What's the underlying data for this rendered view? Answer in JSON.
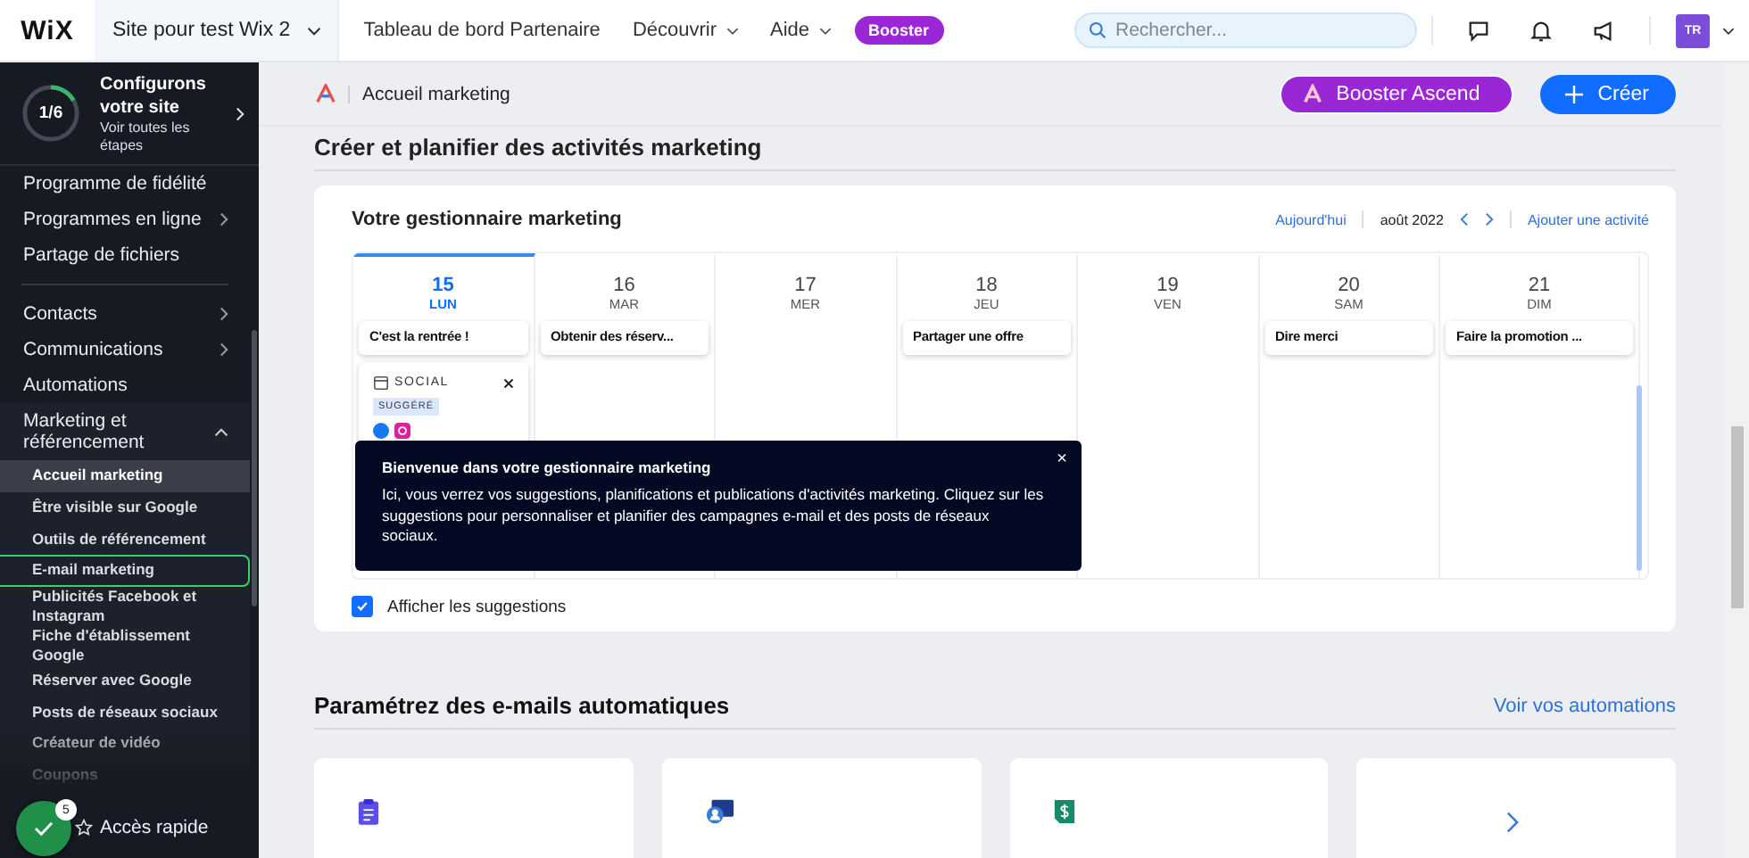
{
  "top_bar": {
    "logo": "WiX",
    "site_selector": "Site pour test Wix 2",
    "nav": [
      {
        "label": "Tableau de bord Partenaire",
        "has_menu": false
      },
      {
        "label": "Découvrir",
        "has_menu": true
      },
      {
        "label": "Aide",
        "has_menu": true
      }
    ],
    "booster": "Booster",
    "search": {
      "placeholder": "Rechercher..."
    },
    "avatar": "TR"
  },
  "sidebar": {
    "setup": {
      "progress": "1/6",
      "level": 0.167,
      "title": "Configurons votre site",
      "link": "Voir toutes les étapes"
    },
    "items": [
      {
        "kind": "item",
        "label": "Programme de fidélité",
        "has_arrow": false
      },
      {
        "kind": "item",
        "label": "Programmes en ligne",
        "has_arrow": true
      },
      {
        "kind": "item",
        "label": "Partage de fichiers",
        "has_arrow": false
      },
      {
        "kind": "divider"
      },
      {
        "kind": "item",
        "label": "Contacts",
        "has_arrow": true
      },
      {
        "kind": "item",
        "label": "Communications",
        "has_arrow": true
      },
      {
        "kind": "item",
        "label": "Automations",
        "has_arrow": false
      },
      {
        "kind": "group",
        "label": "Marketing et référencement",
        "expanded": true,
        "children": [
          {
            "label": "Accueil marketing",
            "selected": true,
            "focused": false
          },
          {
            "label": "Être visible sur Google",
            "selected": false,
            "focused": false
          },
          {
            "label": "Outils de référencement",
            "selected": false,
            "focused": false
          },
          {
            "label": "E-mail marketing",
            "selected": false,
            "focused": true
          },
          {
            "label": "Publicités Facebook et Instagram",
            "selected": false,
            "focused": false
          },
          {
            "label": "Fiche d'établissement Google",
            "selected": false,
            "focused": false
          },
          {
            "label": "Réserver avec Google",
            "selected": false,
            "focused": false
          },
          {
            "label": "Posts de réseaux sociaux",
            "selected": false,
            "focused": false
          },
          {
            "label": "Créateur de vidéo",
            "selected": false,
            "focused": false
          },
          {
            "label": "Coupons",
            "selected": false,
            "focused": false
          }
        ]
      }
    ],
    "quick_access": {
      "label": "Accès rapide",
      "badge": "5"
    }
  },
  "main": {
    "breadcrumb": "Accueil marketing",
    "booster_button": "Booster Ascend",
    "create_button": "Créer",
    "section_title": "Créer et planifier des activités marketing",
    "calendar": {
      "title": "Votre gestionnaire marketing",
      "today": "Aujourd'hui",
      "month": "août 2022",
      "add": "Ajouter une activité",
      "days": [
        {
          "day": "15",
          "weekday": "LUN",
          "selected": true,
          "event": "C'est la rentrée !",
          "suggestion": {
            "label": "SOCIAL",
            "tag": "SUGGÉRÉ"
          }
        },
        {
          "day": "16",
          "weekday": "MAR",
          "selected": false,
          "event": "Obtenir des réserv..."
        },
        {
          "day": "17",
          "weekday": "MER",
          "selected": false
        },
        {
          "day": "18",
          "weekday": "JEU",
          "selected": false,
          "event": "Partager une offre"
        },
        {
          "day": "19",
          "weekday": "VEN",
          "selected": false
        },
        {
          "day": "20",
          "weekday": "SAM",
          "selected": false,
          "event": "Dire merci"
        },
        {
          "day": "21",
          "weekday": "DIM",
          "selected": false,
          "event": "Faire la promotion ..."
        }
      ],
      "tooltip": {
        "title": "Bienvenue dans votre gestionnaire marketing",
        "text": "Ici, vous verrez vos suggestions, planifications et publications d'activités marketing. Cliquez sur les suggestions pour personnaliser et planifier des campagnes e-mail et des posts de réseaux sociaux.",
        "close": "×"
      },
      "show_suggestions": {
        "label": "Afficher les suggestions",
        "checked": true
      }
    },
    "automations": {
      "title": "Paramétrez des e-mails automatiques",
      "link": "Voir vos automations",
      "cards": [
        {
          "kind": "clipboard"
        },
        {
          "kind": "profile"
        },
        {
          "kind": "invoice"
        },
        {
          "kind": "next"
        }
      ]
    }
  }
}
